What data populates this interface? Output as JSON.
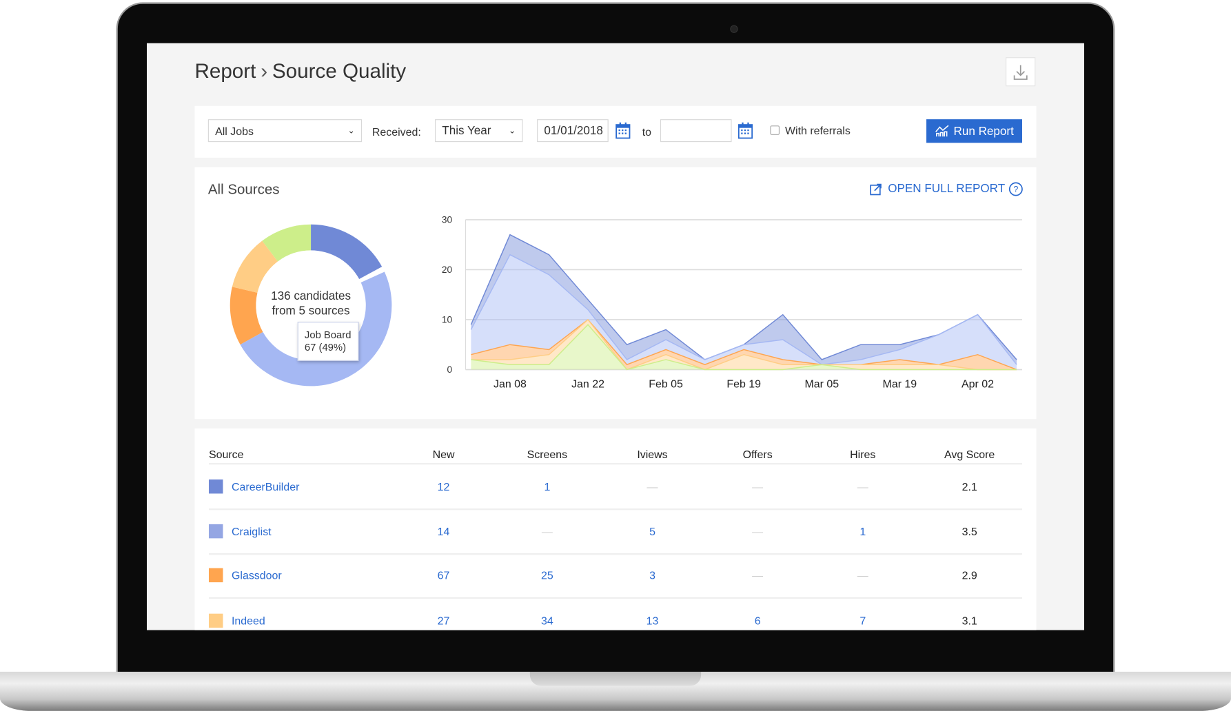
{
  "header": {
    "breadcrumb_root": "Report",
    "breadcrumb_sep": "›",
    "title": "Source Quality",
    "download_icon": "download-icon"
  },
  "filters": {
    "jobs_value": "All Jobs",
    "received_label": "Received:",
    "period_value": "This Year",
    "date_from": "01/01/2018",
    "to_label": "to",
    "date_to": "",
    "referrals_label": "With referrals",
    "referrals_checked": false,
    "run_label": "Run Report"
  },
  "sources_panel": {
    "title": "All Sources",
    "open_full_report": "OPEN FULL REPORT"
  },
  "donut": {
    "center_line1": "136 candidates",
    "center_line2": "from 5 sources",
    "tooltip_name": "Job Board",
    "tooltip_value": "67 (49%)",
    "segments": [
      {
        "value": 24,
        "color": "#7089d6"
      },
      {
        "value": 67,
        "color": "#a5b8f3"
      },
      {
        "value": 16,
        "color": "#ffa54f"
      },
      {
        "value": 15,
        "color": "#ffcd85"
      },
      {
        "value": 14,
        "color": "#cdee8a"
      }
    ]
  },
  "chart_data": {
    "type": "area",
    "stacked": true,
    "x": [
      "Jan 01",
      "Jan 08",
      "Jan 15",
      "Jan 22",
      "Jan 29",
      "Feb 05",
      "Feb 12",
      "Feb 19",
      "Feb 26",
      "Mar 05",
      "Mar 12",
      "Mar 19",
      "Mar 26",
      "Apr 02",
      "Apr 09"
    ],
    "xticks": [
      "Jan 08",
      "Jan 22",
      "Feb 05",
      "Feb 19",
      "Mar 05",
      "Mar 19",
      "Apr 02"
    ],
    "yticks": [
      "0",
      "10",
      "20",
      "30"
    ],
    "ylim": [
      0,
      30
    ],
    "grid": true,
    "series": [
      {
        "color": "#cdee8a",
        "values": [
          2,
          1,
          1,
          9,
          0,
          2,
          0,
          0,
          0,
          1,
          0,
          0,
          0,
          0,
          0
        ]
      },
      {
        "color": "#ffcd85",
        "values": [
          0,
          1,
          2,
          1,
          0,
          1,
          0,
          3,
          1,
          0,
          1,
          1,
          1,
          0,
          0
        ]
      },
      {
        "color": "#ffa54f",
        "values": [
          1,
          3,
          1,
          0,
          1,
          1,
          1,
          1,
          1,
          0,
          0,
          1,
          0,
          3,
          0
        ]
      },
      {
        "color": "#a5b8f3",
        "values": [
          5,
          18,
          15,
          2,
          1,
          2,
          1,
          1,
          4,
          0,
          1,
          2,
          6,
          8,
          1
        ]
      },
      {
        "color": "#7089d6",
        "values": [
          1,
          4,
          4,
          2,
          3,
          2,
          0,
          0,
          5,
          1,
          3,
          1,
          0,
          0,
          1
        ]
      }
    ]
  },
  "table": {
    "headers": [
      "Source",
      "New",
      "Screens",
      "Iviews",
      "Offers",
      "Hires",
      "Avg Score"
    ],
    "rows": [
      {
        "color": "#7089d6",
        "cells": [
          "CareerBuilder",
          "12",
          "1",
          "—",
          "—",
          "—",
          "2.1"
        ]
      },
      {
        "color": "#94a6e3",
        "cells": [
          "Craiglist",
          "14",
          "—",
          "5",
          "—",
          "1",
          "3.5"
        ]
      },
      {
        "color": "#ffa54f",
        "cells": [
          "Glassdoor",
          "67",
          "25",
          "3",
          "—",
          "—",
          "2.9"
        ]
      },
      {
        "color": "#ffcd85",
        "cells": [
          "Indeed",
          "27",
          "34",
          "13",
          "6",
          "7",
          "3.1"
        ]
      }
    ]
  }
}
